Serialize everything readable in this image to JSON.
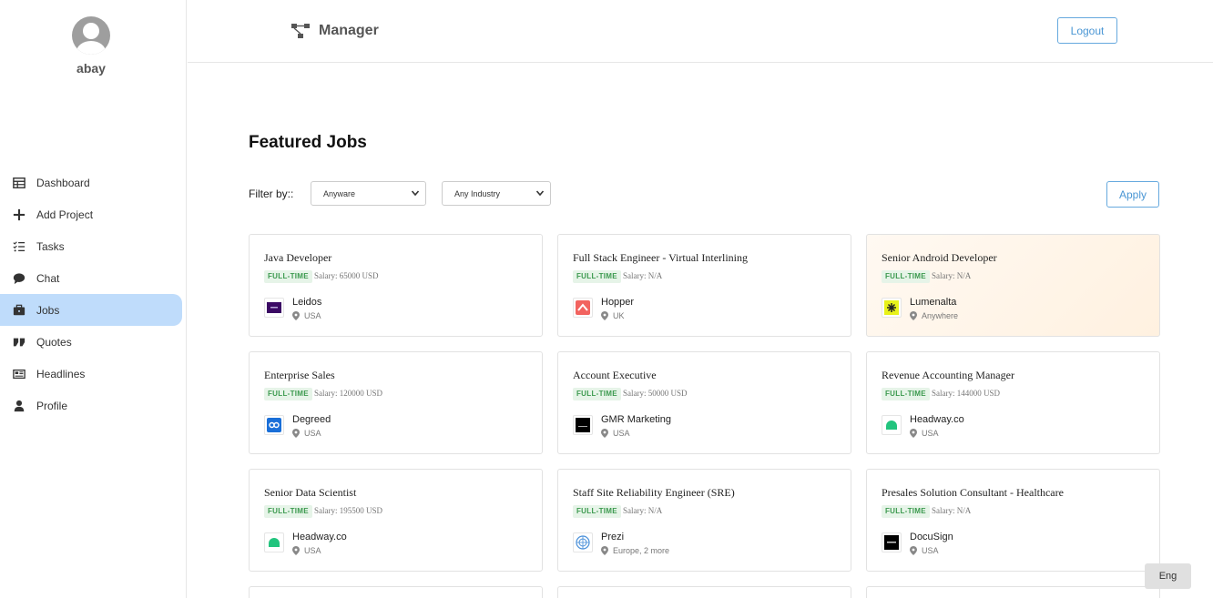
{
  "user": {
    "name": "abay"
  },
  "nav": [
    {
      "label": "Dashboard",
      "icon": "table-icon"
    },
    {
      "label": "Add Project",
      "icon": "plus-icon"
    },
    {
      "label": "Tasks",
      "icon": "tasks-icon"
    },
    {
      "label": "Chat",
      "icon": "chat-icon"
    },
    {
      "label": "Jobs",
      "icon": "briefcase-icon",
      "active": true
    },
    {
      "label": "Quotes",
      "icon": "quote-icon"
    },
    {
      "label": "Headlines",
      "icon": "newspaper-icon"
    },
    {
      "label": "Profile",
      "icon": "user-icon"
    }
  ],
  "header": {
    "title": "Manager",
    "logout_label": "Logout"
  },
  "main": {
    "title": "Featured Jobs",
    "filter_label": "Filter by::",
    "location_filter": "Anyware",
    "industry_filter": "Any Industry",
    "apply_label": "Apply"
  },
  "jobs": [
    {
      "title": "Java Developer",
      "type": "FULL-TIME",
      "salary": "Salary: 65000 USD",
      "company": "Leidos",
      "location": "USA",
      "logo_color": "#3b0a64"
    },
    {
      "title": "Full Stack Engineer - Virtual Interlining",
      "type": "FULL-TIME",
      "salary": "Salary: N/A",
      "company": "Hopper",
      "location": "UK",
      "logo_color": "#f2635f"
    },
    {
      "title": "Senior Android Developer",
      "type": "FULL-TIME",
      "salary": "Salary: N/A",
      "company": "Lumenalta",
      "location": "Anywhere",
      "logo_color": "#e8f21a"
    },
    {
      "title": "Enterprise Sales",
      "type": "FULL-TIME",
      "salary": "Salary: 120000 USD",
      "company": "Degreed",
      "location": "USA",
      "logo_color": "#1a6fd8"
    },
    {
      "title": "Account Executive",
      "type": "FULL-TIME",
      "salary": "Salary: 50000 USD",
      "company": "GMR Marketing",
      "location": "USA",
      "logo_color": "#000000"
    },
    {
      "title": "Revenue Accounting Manager",
      "type": "FULL-TIME",
      "salary": "Salary: 144000 USD",
      "company": "Headway.co",
      "location": "USA",
      "logo_color": "#22c47e"
    },
    {
      "title": "Senior Data Scientist",
      "type": "FULL-TIME",
      "salary": "Salary: 195500 USD",
      "company": "Headway.co",
      "location": "USA",
      "logo_color": "#22c47e"
    },
    {
      "title": "Staff Site Reliability Engineer (SRE)",
      "type": "FULL-TIME",
      "salary": "Salary: N/A",
      "company": "Prezi",
      "location": "Europe, 2 more",
      "logo_color": "#4a90d9"
    },
    {
      "title": "Presales Solution Consultant - Healthcare",
      "type": "FULL-TIME",
      "salary": "Salary: N/A",
      "company": "DocuSign",
      "location": "USA",
      "logo_color": "#000000"
    }
  ],
  "language_button": "Eng",
  "colors": {
    "accent": "#4a96d4",
    "active_nav": "#bfdcfb",
    "badge_bg": "#e6f4e8",
    "badge_text": "#3c9a4f"
  }
}
